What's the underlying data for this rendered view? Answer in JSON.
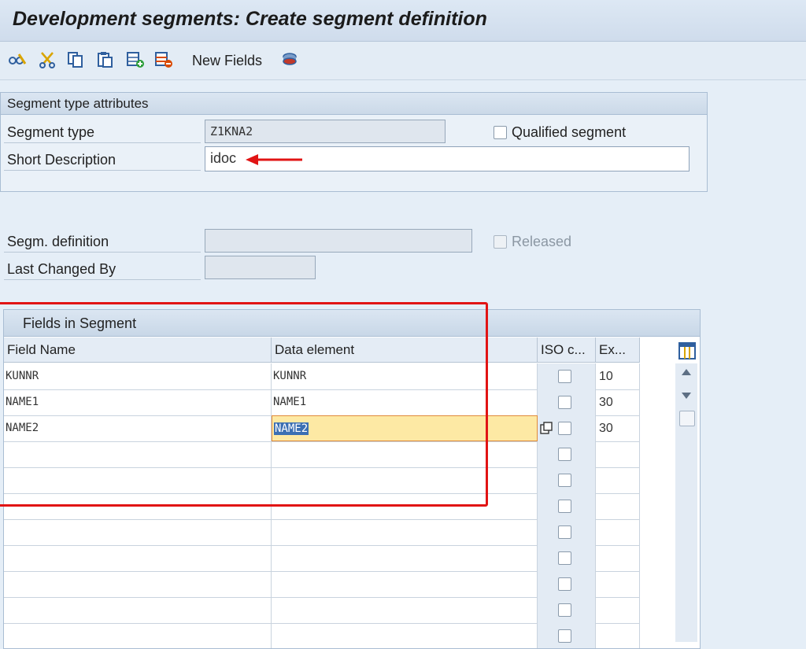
{
  "window": {
    "title": "Development segments: Create segment definition"
  },
  "toolbar": {
    "icons": [
      "glasses-edit-icon",
      "cut-icon",
      "copy-icon",
      "paste-icon",
      "insert-row-icon",
      "delete-row-icon",
      "object-stack-icon"
    ],
    "new_fields_label": "New Fields"
  },
  "attributes": {
    "header": "Segment type attributes",
    "segment_type_label": "Segment type",
    "segment_type_value": "Z1KNA2",
    "qualified_label": "Qualified segment",
    "short_desc_label": "Short Description",
    "short_desc_value": "idoc"
  },
  "definition": {
    "segm_def_label": "Segm. definition",
    "released_label": "Released",
    "last_changed_label": "Last Changed By"
  },
  "fields_table": {
    "title": "Fields in Segment",
    "columns": [
      "Field Name",
      "Data element",
      "ISO c...",
      "Ex..."
    ],
    "rows": [
      {
        "field": "KUNNR",
        "element": "KUNNR",
        "export_len": "10"
      },
      {
        "field": "NAME1",
        "element": "NAME1",
        "export_len": "30"
      },
      {
        "field": "NAME2",
        "element": "NAME2",
        "export_len": "30"
      }
    ]
  },
  "colors": {
    "accent": "#e11414",
    "selection": "#fde9a4",
    "highlight": "#3b6fb3"
  }
}
